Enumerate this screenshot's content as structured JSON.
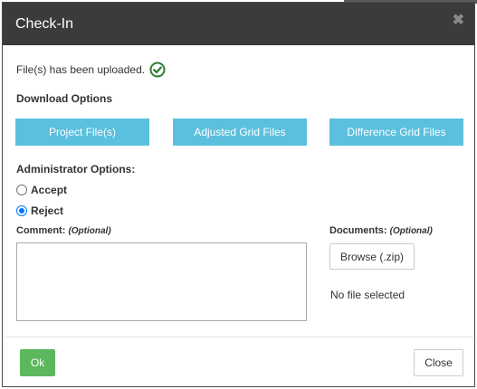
{
  "dialog": {
    "title": "Check-In",
    "close_glyph": "✖"
  },
  "status": {
    "uploaded_text": "File(s) has been uploaded.",
    "icon": "check-circle-icon",
    "icon_color": "#2e7d32"
  },
  "download": {
    "label": "Download Options",
    "buttons": [
      {
        "label": "Project File(s)"
      },
      {
        "label": "Adjusted Grid Files"
      },
      {
        "label": "Difference Grid Files"
      }
    ],
    "button_color": "#5bc0de"
  },
  "admin": {
    "label": "Administrator Options:",
    "options": [
      {
        "label": "Accept",
        "checked": false
      },
      {
        "label": "Reject",
        "checked": true
      }
    ]
  },
  "comment": {
    "label": "Comment:",
    "optional": "(Optional)",
    "value": ""
  },
  "documents": {
    "label": "Documents:",
    "optional": "(Optional)",
    "browse_label": "Browse (.zip)",
    "file_status": "No file selected"
  },
  "footer": {
    "ok_label": "Ok",
    "close_label": "Close",
    "ok_color": "#5cb85c"
  }
}
